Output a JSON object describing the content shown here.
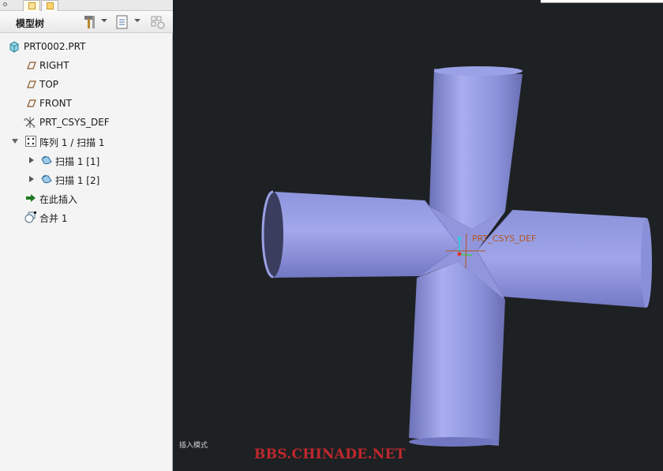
{
  "panel": {
    "title": "模型树"
  },
  "tree": {
    "items": [
      {
        "label": "PRT0002.PRT",
        "icon": "part-icon"
      },
      {
        "label": "RIGHT",
        "icon": "datum-plane-icon"
      },
      {
        "label": "TOP",
        "icon": "datum-plane-icon"
      },
      {
        "label": "FRONT",
        "icon": "datum-plane-icon"
      },
      {
        "label": "PRT_CSYS_DEF",
        "icon": "coordinate-system-icon"
      },
      {
        "label": "阵列 1 / 扫描 1",
        "icon": "pattern-icon",
        "expanded": true
      },
      {
        "label": "扫描 1 [1]",
        "icon": "sweep-icon",
        "expanded": false
      },
      {
        "label": "扫描 1 [2]",
        "icon": "sweep-icon",
        "expanded": false
      },
      {
        "label": "在此插入",
        "icon": "insert-here-arrow-icon"
      },
      {
        "label": "合并 1",
        "icon": "merge-icon"
      }
    ]
  },
  "viewport": {
    "csys_label": "PRT_CSYS_DEF",
    "mode_text": "插入模式",
    "watermark": "BBS.CHINADE.NET"
  },
  "colors": {
    "background": "#1d2123",
    "solid": "#8a90d8",
    "watermark": "#c0282d",
    "csys_label": "#b4551c"
  }
}
